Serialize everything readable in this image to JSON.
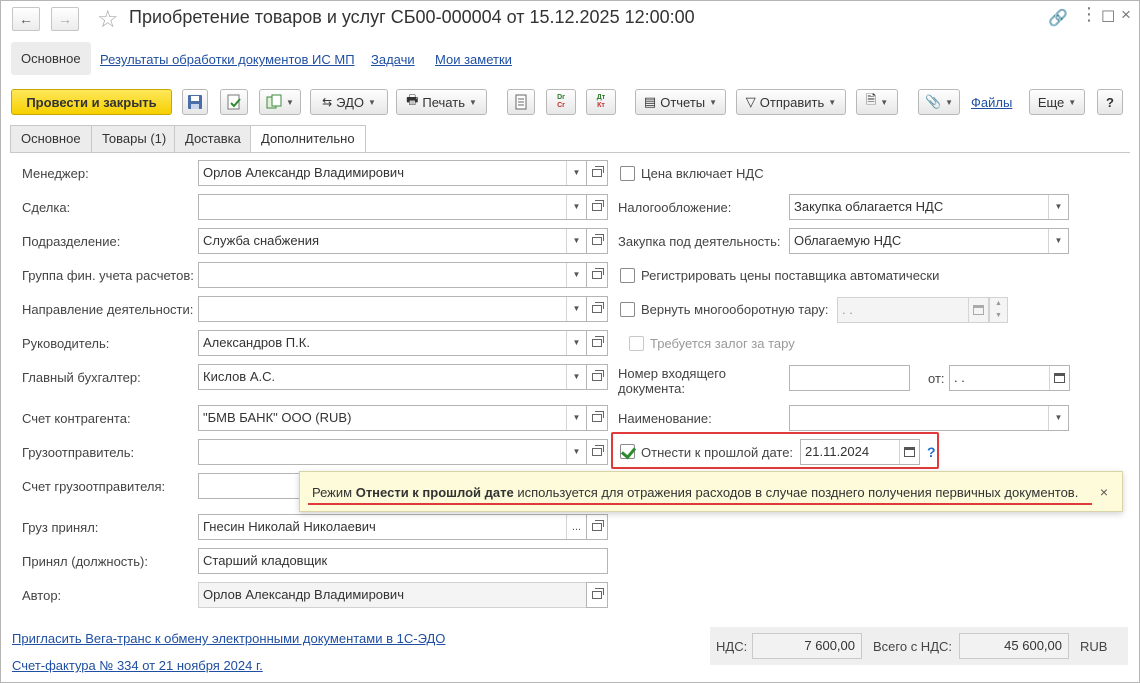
{
  "window": {
    "title": "Приобретение товаров и услуг СБ00-000004 от 15.12.2025 12:00:00"
  },
  "sections": {
    "main": "Основное",
    "links": [
      "Результаты обработки документов ИС МП",
      "Задачи",
      "Мои заметки"
    ]
  },
  "toolbar": {
    "post_close": "Провести и закрыть",
    "edo": "ЭДО",
    "print": "Печать",
    "dt_kt_top": "Dr",
    "dt_kt_bottom": "Cr",
    "dt_ru_top": "Дт",
    "dt_ru_bottom": "Кт",
    "reports": "Отчеты",
    "send": "Отправить",
    "files": "Файлы",
    "more": "Еще",
    "help": "?"
  },
  "tabs": [
    "Основное",
    "Товары (1)",
    "Доставка",
    "Дополнительно"
  ],
  "left_form": {
    "manager_label": "Менеджер:",
    "manager_value": "Орлов Александр Владимирович",
    "deal_label": "Сделка:",
    "deal_value": "",
    "division_label": "Подразделение:",
    "division_value": "Служба снабжения",
    "fin_group_label": "Группа фин. учета расчетов:",
    "fin_group_value": "",
    "direction_label": "Направление деятельности:",
    "direction_value": "",
    "head_label": "Руководитель:",
    "head_value": "Александров П.К.",
    "accountant_label": "Главный бухгалтер:",
    "accountant_value": "Кислов А.С.",
    "account_label": "Счет контрагента:",
    "account_value": "\"БМВ БАНК\" ООО (RUB)",
    "shipper_label": "Грузоотправитель:",
    "shipper_value": "",
    "shipper_account_label": "Счет грузоотправителя:",
    "shipper_account_value": "",
    "received_label": "Груз принял:",
    "received_value": "Гнесин Николай Николаевич",
    "position_label": "Принял (должность):",
    "position_value": "Старший кладовщик",
    "author_label": "Автор:",
    "author_value": "Орлов Александр Владимирович"
  },
  "right_form": {
    "vat_included_label": "Цена включает НДС",
    "taxation_label": "Налогообложение:",
    "taxation_value": "Закупка облагается НДС",
    "purchase_activity_label": "Закупка под деятельность:",
    "purchase_activity_value": "Облагаемую НДС",
    "register_prices_label": "Регистрировать цены поставщика автоматически",
    "return_tare_label": "Вернуть многооборотную тару:",
    "return_tare_date": " .  .",
    "deposit_label": "Требуется залог за тару",
    "incoming_num_label_1": "Номер входящего",
    "incoming_num_label_2": "документа:",
    "incoming_num_value": "",
    "from_label": "от:",
    "from_value": " .  .",
    "name_label": "Наименование:",
    "name_value": "",
    "past_date_label": "Отнести к прошлой дате:",
    "past_date_value": "21.11.2024",
    "past_date_checked": true,
    "help": "?"
  },
  "tooltip": {
    "prefix": "Режим ",
    "bold": "Отнести к прошлой дате",
    "suffix": " используется для отражения расходов в случае позднего получения первичных документов.",
    "close": "×"
  },
  "footer": {
    "invite_link": "Пригласить Вега-транс к обмену электронными документами в 1С-ЭДО",
    "invoice_link": "Счет-фактура № 334 от 21 ноября 2024 г.",
    "vat_label": "НДС:",
    "vat_value": "7 600,00",
    "total_label": "Всего с НДС:",
    "total_value": "45 600,00",
    "currency": "RUB"
  },
  "colors": {
    "primary_button": "#f6d000",
    "link": "#1f4fa2",
    "highlight": "#e03a3a",
    "check": "#2d8a2d"
  }
}
